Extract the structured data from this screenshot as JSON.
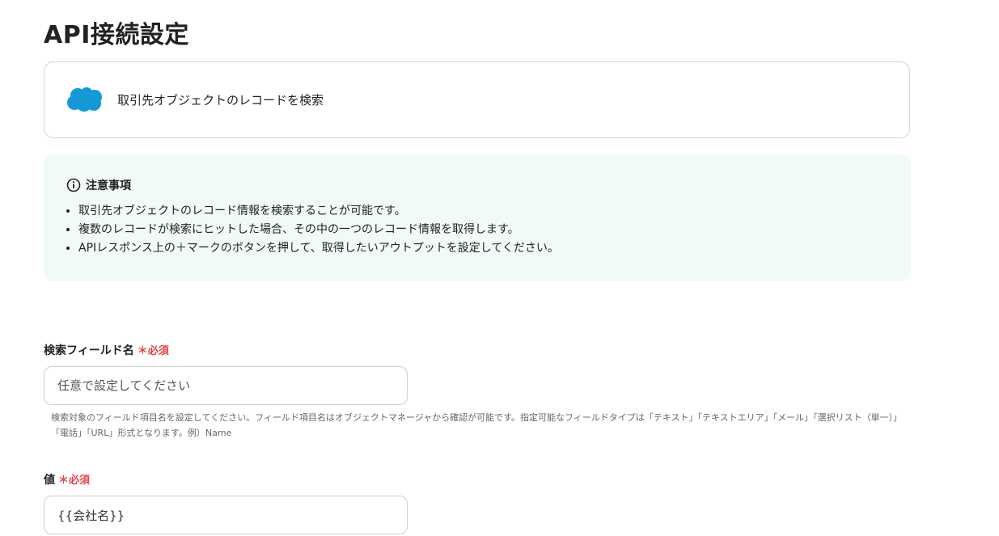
{
  "page": {
    "title": "API接続設定"
  },
  "action": {
    "app_icon": "salesforce-cloud-icon",
    "label": "取引先オブジェクトのレコードを検索",
    "brand_color": "#1798d6"
  },
  "notice": {
    "icon": "info-icon",
    "title": "注意事項",
    "items": [
      "取引先オブジェクトのレコード情報を検索することが可能です。",
      "複数のレコードが検索にヒットした場合、その中の一つのレコード情報を取得します。",
      "APIレスポンス上の＋マークのボタンを押して、取得したいアウトプットを設定してください。"
    ],
    "background_color": "#f1f9f9"
  },
  "fields": [
    {
      "label": "検索フィールド名",
      "required_label": "必須",
      "value": "",
      "placeholder": "任意で設定してください",
      "help": "検索対象のフィールド項目名を設定してください。フィールド項目名はオブジェクトマネージャから確認が可能です。指定可能なフィールドタイプは「テキスト」「テキストエリア」「メール」「選択リスト（単一）」「電話」「URL」形式となります。例）Name"
    },
    {
      "label": "値",
      "required_label": "必須",
      "value": "{{会社名}}",
      "placeholder": ""
    }
  ],
  "colors": {
    "required": "#e0454a",
    "border": "#cfcfcf"
  }
}
